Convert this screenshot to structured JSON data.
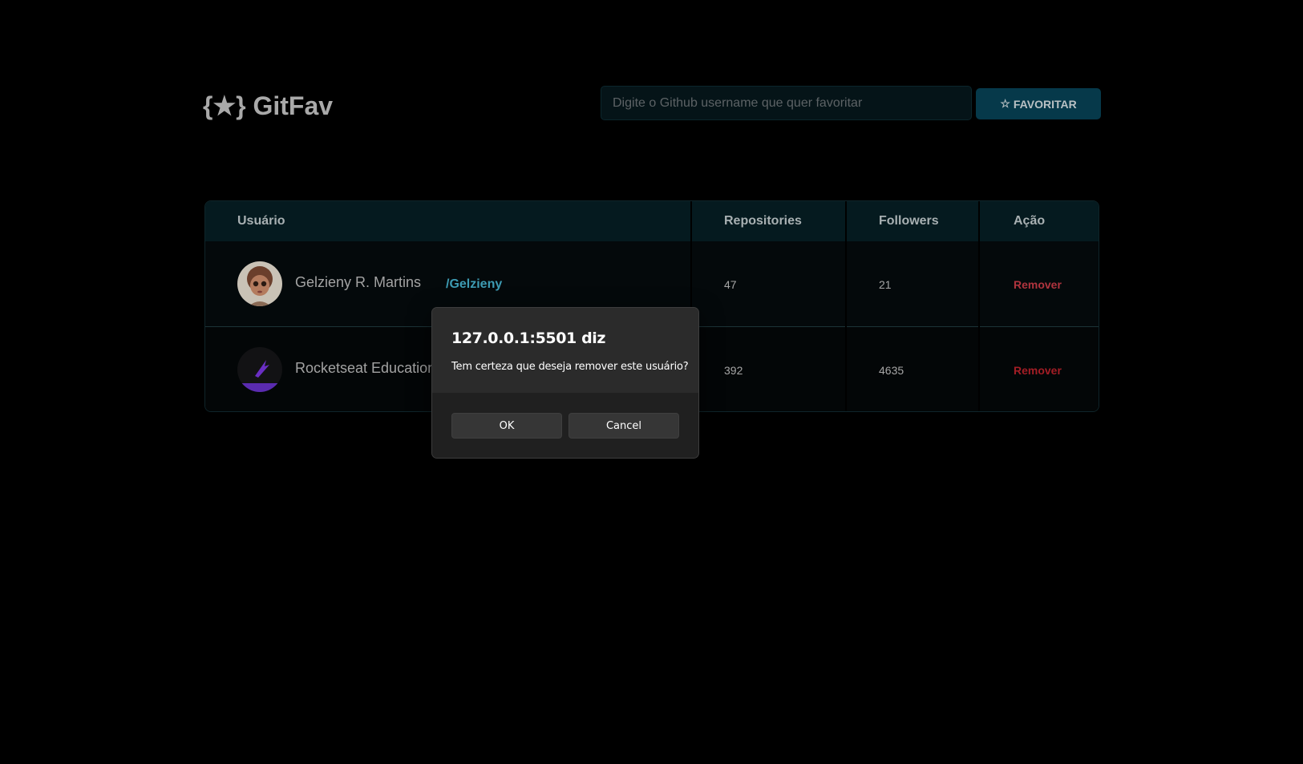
{
  "header": {
    "logo_text": "{★} GitFav",
    "search_placeholder": "Digite o Github username que quer favoritar",
    "favorite_button_label": "FAVORITAR",
    "favorite_button_icon": "star-outline-icon"
  },
  "table": {
    "columns": [
      "Usuário",
      "Repositories",
      "Followers",
      "Ação"
    ],
    "rows": [
      {
        "name": "Gelzieny R. Martins",
        "login": "/Gelzieny",
        "repositories": "47",
        "followers": "21",
        "action": "Remover"
      },
      {
        "name": "Rocketseat Education",
        "login": "",
        "repositories": "392",
        "followers": "4635",
        "action": "Remover"
      }
    ]
  },
  "dialog": {
    "title": "127.0.0.1:5501 diz",
    "message": "Tem certeza que deseja remover este usuário?",
    "ok_label": "OK",
    "cancel_label": "Cancel"
  },
  "colors": {
    "background": "#000000",
    "accent": "#06394a",
    "link": "#3d9bb3",
    "danger": "#a31d25"
  }
}
